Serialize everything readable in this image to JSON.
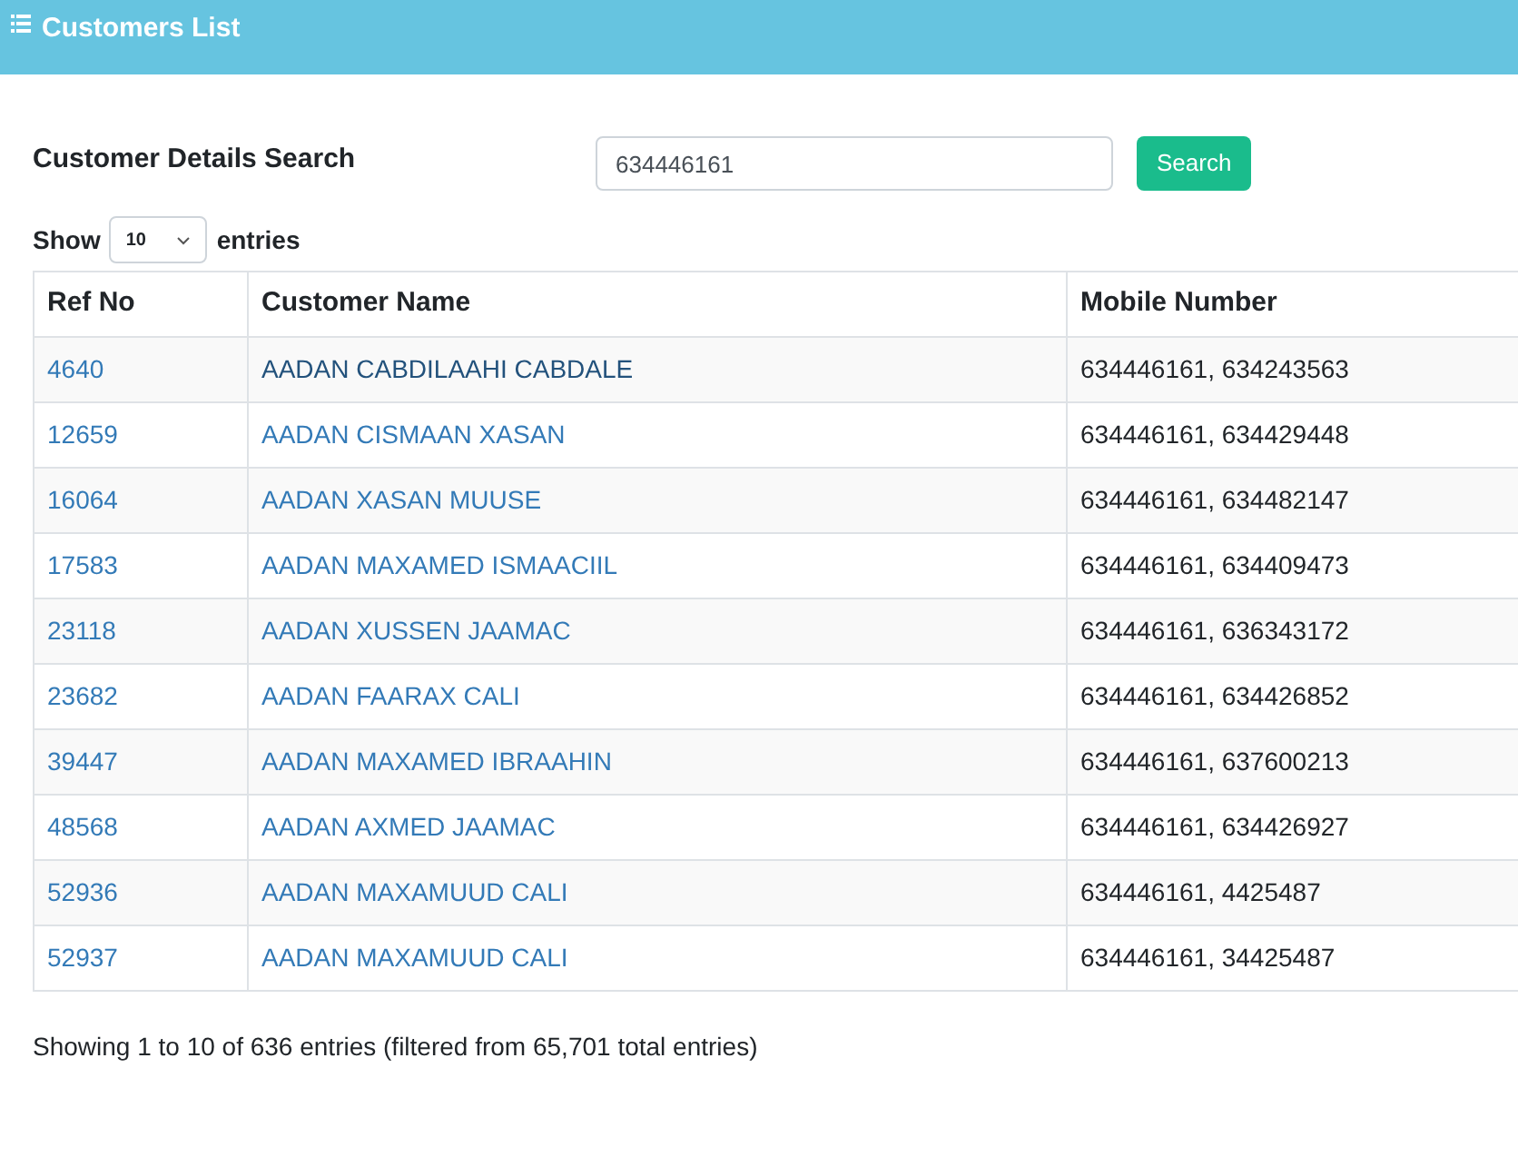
{
  "header": {
    "title": "Customers List"
  },
  "search": {
    "label": "Customer Details Search",
    "value": "634446161",
    "button": "Search"
  },
  "length": {
    "before": "Show",
    "value": "10",
    "after": "entries"
  },
  "table": {
    "columns": [
      "Ref No",
      "Customer Name",
      "Mobile Number"
    ],
    "rows": [
      {
        "ref": "4640",
        "name": "AADAN CABDILAAHI CABDALE",
        "mobile": "634446161, 634243563",
        "hovered": true
      },
      {
        "ref": "12659",
        "name": "AADAN CISMAAN XASAN",
        "mobile": "634446161, 634429448",
        "hovered": false
      },
      {
        "ref": "16064",
        "name": "AADAN XASAN MUUSE",
        "mobile": "634446161, 634482147",
        "hovered": false
      },
      {
        "ref": "17583",
        "name": "AADAN MAXAMED ISMAACIIL",
        "mobile": "634446161, 634409473",
        "hovered": false
      },
      {
        "ref": "23118",
        "name": "AADAN XUSSEN JAAMAC",
        "mobile": "634446161, 636343172",
        "hovered": false
      },
      {
        "ref": "23682",
        "name": "AADAN FAARAX CALI",
        "mobile": "634446161, 634426852",
        "hovered": false
      },
      {
        "ref": "39447",
        "name": "AADAN MAXAMED IBRAAHIN",
        "mobile": "634446161, 637600213",
        "hovered": false
      },
      {
        "ref": "48568",
        "name": "AADAN AXMED JAAMAC",
        "mobile": "634446161, 634426927",
        "hovered": false
      },
      {
        "ref": "52936",
        "name": "AADAN MAXAMUUD CALI",
        "mobile": "634446161, 4425487",
        "hovered": false
      },
      {
        "ref": "52937",
        "name": "AADAN MAXAMUUD CALI",
        "mobile": "634446161, 34425487",
        "hovered": false
      }
    ]
  },
  "info": "Showing 1 to 10 of 636 entries (filtered from 65,701 total entries)"
}
